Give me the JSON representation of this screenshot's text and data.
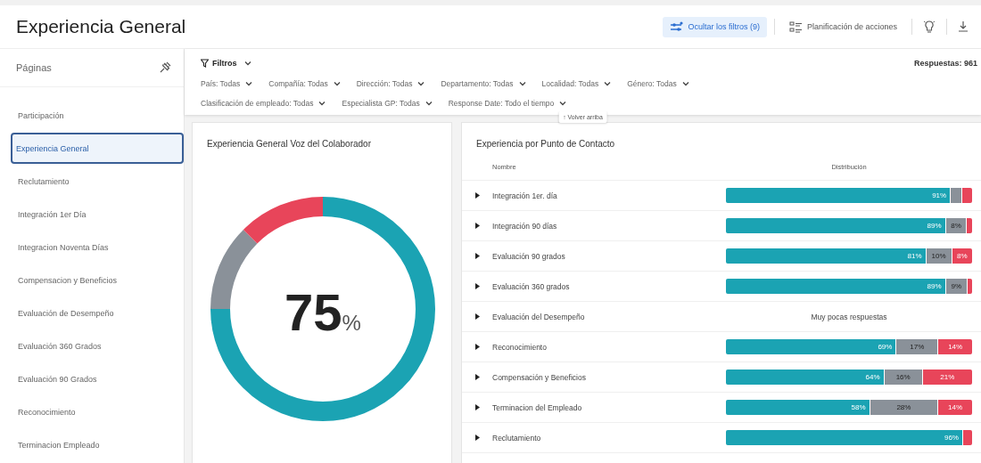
{
  "header": {
    "title": "Experiencia General",
    "buttons": [
      {
        "label": "Ocultar los filtros (9)",
        "kind": "filters",
        "selected": true
      },
      {
        "label": "Planificación de acciones",
        "kind": "plan",
        "selected": false
      }
    ]
  },
  "sidebar": {
    "title": "Páginas",
    "items": [
      {
        "label": "Participación",
        "selected": false
      },
      {
        "label": "Experiencia General",
        "selected": true
      },
      {
        "label": "Reclutamiento",
        "selected": false
      },
      {
        "label": "Integración 1er Día",
        "selected": false
      },
      {
        "label": "Integracion Noventa Días",
        "selected": false
      },
      {
        "label": "Compensacion y Beneficios",
        "selected": false
      },
      {
        "label": "Evaluación de Desempeño",
        "selected": false
      },
      {
        "label": "Evaluación 360 Grados",
        "selected": false
      },
      {
        "label": "Evaluación 90 Grados",
        "selected": false
      },
      {
        "label": "Reconocimiento",
        "selected": false
      },
      {
        "label": "Terminacion Empleado",
        "selected": false
      }
    ]
  },
  "filters": {
    "title": "Filtros",
    "responses": "Respuestas: 961",
    "back_to_top": "↑ Volver arriba",
    "items": [
      {
        "label": "País:",
        "value": "Todas"
      },
      {
        "label": "Compañía:",
        "value": "Todas"
      },
      {
        "label": "Dirección:",
        "value": "Todas"
      },
      {
        "label": "Departamento:",
        "value": "Todas"
      },
      {
        "label": "Localidad:",
        "value": "Todas"
      },
      {
        "label": "Género:",
        "value": "Todas"
      },
      {
        "label": "Clasificación de empleado:",
        "value": "Todas"
      },
      {
        "label": "Especialista GP:",
        "value": "Todas"
      },
      {
        "label": "Response Date:",
        "value": "Todo el tiempo"
      }
    ]
  },
  "gauge_card": {
    "title": "Experiencia General Voz del Colaborador",
    "value": "75",
    "unit": "%",
    "segments": [
      {
        "color": "#1ba3b3"
      },
      {
        "color": "#8a9199"
      },
      {
        "color": "#e8455a"
      }
    ]
  },
  "table_card": {
    "title": "Experiencia por Punto de Contacto",
    "columns": [
      "Nombre",
      "Distribución"
    ],
    "rows": [
      {
        "name": "Integración 1er. día",
        "segments": [
          {
            "kind": "positive",
            "level": 0.91,
            "label": "91%"
          },
          {
            "kind": "neutral"
          },
          {
            "kind": "negative"
          }
        ]
      },
      {
        "name": "Integración 90 días",
        "segments": [
          {
            "kind": "positive",
            "level": 0.89,
            "label": "89%"
          },
          {
            "kind": "neutral",
            "label": "8%"
          },
          {
            "kind": "negative"
          }
        ]
      },
      {
        "name": "Evaluación 90 grados",
        "segments": [
          {
            "kind": "positive",
            "level": 0.81,
            "label": "81%"
          },
          {
            "kind": "neutral",
            "label": "10%"
          },
          {
            "kind": "negative",
            "label": "8%"
          }
        ]
      },
      {
        "name": "Evaluación 360 grados",
        "segments": [
          {
            "kind": "positive",
            "level": 0.89,
            "label": "89%"
          },
          {
            "kind": "neutral",
            "label": "9%"
          },
          {
            "kind": "negative"
          }
        ]
      },
      {
        "name": "Evaluación del Desempeño",
        "note": "Muy pocas respuestas"
      },
      {
        "name": "Reconocimiento",
        "segments": [
          {
            "kind": "positive",
            "level": 0.69,
            "label": "69%"
          },
          {
            "kind": "neutral",
            "label": "17%"
          },
          {
            "kind": "negative",
            "label": "14%"
          }
        ]
      },
      {
        "name": "Compensación y Beneficios",
        "segments": [
          {
            "kind": "positive",
            "level": 0.64,
            "label": "64%"
          },
          {
            "kind": "neutral",
            "label": "16%"
          },
          {
            "kind": "negative",
            "label": "21%"
          }
        ]
      },
      {
        "name": "Terminacion del Empleado",
        "segments": [
          {
            "kind": "positive",
            "label": "58%"
          },
          {
            "kind": "neutral",
            "label": "28%"
          },
          {
            "kind": "negative",
            "label": "14%"
          }
        ]
      },
      {
        "name": "Reclutamiento",
        "segments": [
          {
            "kind": "positive",
            "level": 0.96,
            "label": "96%"
          },
          {
            "kind": "negative"
          }
        ]
      }
    ]
  }
}
